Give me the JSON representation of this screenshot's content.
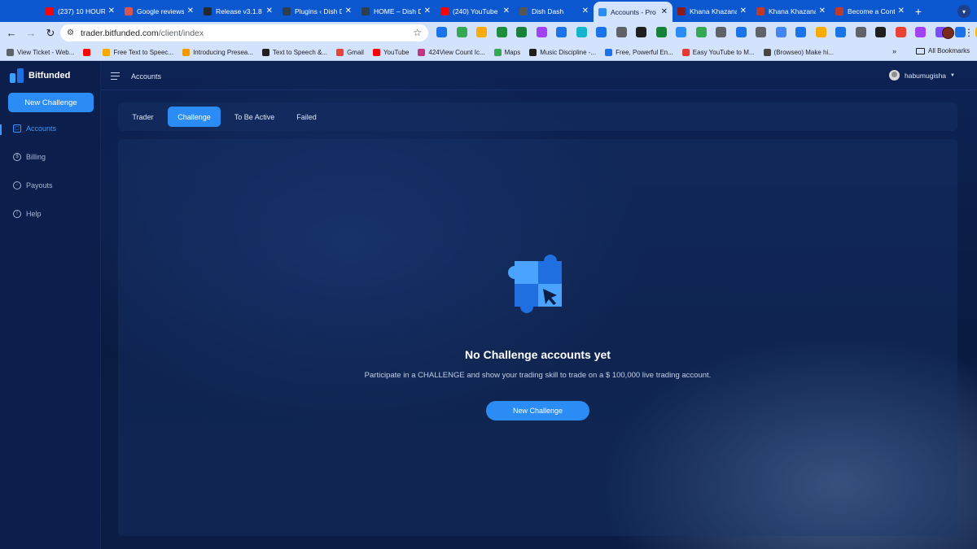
{
  "browser": {
    "tabs": [
      {
        "title": "(237) 10 HOUR",
        "fav_color": "#ff0000",
        "fav_icon": "youtube-icon"
      },
      {
        "title": "Google reviews",
        "fav_color": "#d9534f",
        "fav_icon": "sparkle-icon"
      },
      {
        "title": "Release v3.1.8",
        "fav_color": "#24292f",
        "fav_icon": "github-icon"
      },
      {
        "title": "Plugins ‹ Dish D",
        "fav_color": "#2c3e50",
        "fav_icon": "wordpress-icon"
      },
      {
        "title": "HOME – Dish Da",
        "fav_color": "#2c3e50",
        "fav_icon": "wordpress-icon"
      },
      {
        "title": "(240) YouTube",
        "fav_color": "#ff0000",
        "fav_icon": "youtube-icon"
      },
      {
        "title": "Dish Dash",
        "fav_color": "#555555",
        "fav_icon": "page-icon"
      },
      {
        "title": "Accounts - Pro",
        "fav_color": "#2b8cf5",
        "fav_icon": "bitfunded-icon",
        "active": true
      },
      {
        "title": "Khana Khazana",
        "fav_color": "#8b1a1a",
        "fav_icon": "khana-icon"
      },
      {
        "title": "Khana Khazana",
        "fav_color": "#c0392b",
        "fav_icon": "khana-icon"
      },
      {
        "title": "Become a Cont",
        "fav_color": "#c0392b",
        "fav_icon": "shield-icon"
      }
    ],
    "new_tab": "+",
    "url_host": "trader.bitfunded.com",
    "url_path": "/client/index",
    "extension_colors": [
      "#1a73e8",
      "#34a853",
      "#f9ab00",
      "#1e8e3e",
      "#188038",
      "#a142f4",
      "#1a73e8",
      "#12b5cb",
      "#1a73e8",
      "#5f6368",
      "#1f1f1f",
      "#188038",
      "#2b8cf5",
      "#34a853",
      "#5f6368",
      "#1a73e8",
      "#5f6368",
      "#4285f4",
      "#1a73e8",
      "#f9ab00",
      "#1a73e8",
      "#5f6368",
      "#1f1f1f",
      "#ea4335",
      "#a142f4",
      "#7c4dff",
      "#1a73e8",
      "#fbbc04",
      "#f29900",
      "#5f6368"
    ],
    "bookmarks": [
      {
        "label": "View Ticket - Web...",
        "fav_color": "#5f6368"
      },
      {
        "label": "",
        "fav_color": "#ff0000"
      },
      {
        "label": "Free Text to Speec...",
        "fav_color": "#f9ab00"
      },
      {
        "label": "Introducing Presea...",
        "fav_color": "#f29900"
      },
      {
        "label": "Text to Speech &...",
        "fav_color": "#1f1f1f"
      },
      {
        "label": "Gmail",
        "fav_color": "#ea4335"
      },
      {
        "label": "YouTube",
        "fav_color": "#ff0000"
      },
      {
        "label": "424View Count Ic...",
        "fav_color": "#c13584"
      },
      {
        "label": "Maps",
        "fav_color": "#34a853"
      },
      {
        "label": "Music Discipline -...",
        "fav_color": "#1f1f1f"
      },
      {
        "label": "Free, Powerful En...",
        "fav_color": "#1a73e8"
      },
      {
        "label": "Easy YouTube to M...",
        "fav_color": "#e53935"
      },
      {
        "label": "(Browseo) Make hi...",
        "fav_color": "#464646"
      }
    ],
    "bookmarks_more": "»",
    "all_bookmarks": "All Bookmarks"
  },
  "app": {
    "brand": "Bitfunded",
    "new_challenge_label": "New Challenge",
    "nav": [
      {
        "label": "Accounts",
        "icon": "wallet-icon",
        "glyph": "▢",
        "active": true
      },
      {
        "label": "Billing",
        "icon": "dollar-icon",
        "glyph": "$"
      },
      {
        "label": "Payouts",
        "icon": "payouts-icon",
        "glyph": "◦"
      },
      {
        "label": "Help",
        "icon": "help-icon",
        "glyph": "!"
      }
    ],
    "page_title": "Accounts",
    "username": "habumugisha",
    "tabs": [
      {
        "label": "Trader"
      },
      {
        "label": "Challenge",
        "active": true
      },
      {
        "label": "To Be Active"
      },
      {
        "label": "Failed"
      }
    ],
    "empty": {
      "title": "No Challenge accounts yet",
      "description": "Participate in a CHALLENGE and show your trading skill to trade on a $ 100,000 live trading account.",
      "button": "New Challenge"
    },
    "colors": {
      "accent": "#2b8cf5",
      "background": "#0a1b42",
      "sidebar": "#0c1f4c",
      "active_nav": "#3f95ff"
    }
  }
}
